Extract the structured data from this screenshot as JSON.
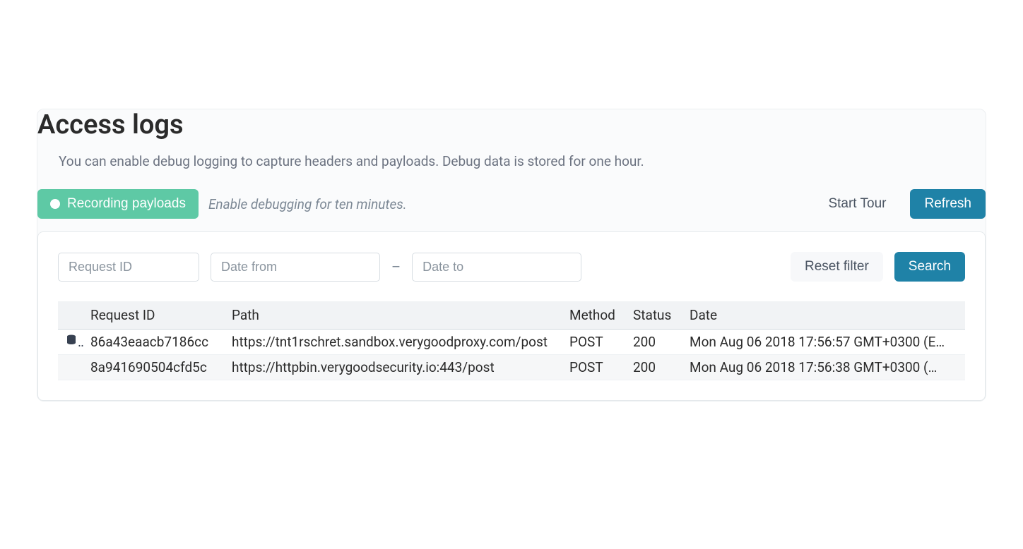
{
  "header": {
    "title": "Access logs",
    "description": "You can enable debug logging to capture headers and payloads. Debug data is stored for one hour."
  },
  "toolbar": {
    "recording_label": "Recording payloads",
    "debug_hint": "Enable debugging for ten minutes.",
    "start_tour_label": "Start Tour",
    "refresh_label": "Refresh"
  },
  "filters": {
    "request_id_placeholder": "Request ID",
    "date_from_placeholder": "Date from",
    "date_to_placeholder": "Date to",
    "range_separator": "–",
    "reset_label": "Reset filter",
    "search_label": "Search"
  },
  "table": {
    "columns": {
      "request_id": "Request ID",
      "path": "Path",
      "method": "Method",
      "status": "Status",
      "date": "Date"
    },
    "rows": [
      {
        "has_icon": true,
        "request_id": "86a43eaacb7186cc",
        "path": "https://tnt1rschret.sandbox.verygoodproxy.com/post",
        "method": "POST",
        "status": "200",
        "date": "Mon Aug 06 2018 17:56:57 GMT+0300 (E…"
      },
      {
        "has_icon": false,
        "request_id": "8a941690504cfd5c",
        "path": "https://httpbin.verygoodsecurity.io:443/post",
        "method": "POST",
        "status": "200",
        "date": "Mon Aug 06 2018 17:56:38 GMT+0300 (…"
      }
    ]
  }
}
